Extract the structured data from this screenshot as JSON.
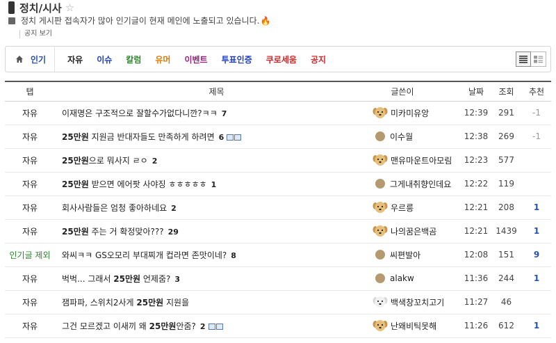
{
  "header": {
    "title": "정치/시사",
    "notice": "정치 게시판 접속자가 많아 인기글이 현재 메인에 노출되고 있습니다.",
    "notice_link": "공지 보기"
  },
  "tabs": {
    "home": "인기",
    "items": [
      {
        "label": "자유",
        "color": "#222222"
      },
      {
        "label": "이슈",
        "color": "#2040c0"
      },
      {
        "label": "칼럼",
        "color": "#2a8a2a"
      },
      {
        "label": "유머",
        "color": "#e07b00"
      },
      {
        "label": "이벤트",
        "color": "#9a1f7c"
      },
      {
        "label": "투표인증",
        "color": "#2040c0"
      },
      {
        "label": "쿠로세움",
        "color": "#d4252a"
      },
      {
        "label": "공지",
        "color": "#d4252a"
      }
    ]
  },
  "table": {
    "headers": {
      "tab": "탭",
      "title": "제목",
      "writer": "글쓴이",
      "date": "날짜",
      "views": "조회",
      "rec": "추천"
    },
    "rows": [
      {
        "tab": "자유",
        "pre": "이재명은 구조적으로 잘할수가없다니깐?ㅋㅋ",
        "bold": "",
        "post": "",
        "comments": "7",
        "img": false,
        "avatar": "dog",
        "writer": "미카미유앙",
        "date": "12:39",
        "views": "291",
        "rec": "-1"
      },
      {
        "tab": "자유",
        "pre": "",
        "bold": "25만원",
        "post": " 지원금 반대자들도 만족하게 하려면",
        "comments": "6",
        "img": true,
        "avatar": "dot",
        "writer": "이수월",
        "date": "12:38",
        "views": "269",
        "rec": "-1"
      },
      {
        "tab": "자유",
        "pre": "",
        "bold": "25만원",
        "post": "으로 뭐사지 ㄹㅇ",
        "comments": "2",
        "img": false,
        "avatar": "dog",
        "writer": "맨유마운트아모림",
        "date": "12:23",
        "views": "577",
        "rec": ""
      },
      {
        "tab": "자유",
        "pre": "",
        "bold": "25만원",
        "post": " 받으면 에어팟 사야징 ㅎㅎㅎㅎㅎ",
        "comments": "1",
        "img": false,
        "avatar": "dot",
        "writer": "그게내취향인데요",
        "date": "12:22",
        "views": "119",
        "rec": ""
      },
      {
        "tab": "자유",
        "pre": "회사사람들은 엄청 좋아하네요",
        "bold": "",
        "post": "",
        "comments": "2",
        "img": false,
        "avatar": "dog",
        "writer": "우르릉",
        "date": "12:21",
        "views": "208",
        "rec": "1"
      },
      {
        "tab": "자유",
        "pre": "",
        "bold": "25만원",
        "post": " 주는 거 확정맞아???",
        "comments": "29",
        "img": false,
        "avatar": "dog2",
        "writer": "나의꿈은백곰",
        "date": "12:21",
        "views": "1439",
        "rec": "1"
      },
      {
        "tab": "인기글 제외",
        "pre": "와씨ㅋㅋ GS오모리 부대찌개 컵라면 존맛이네?",
        "bold": "",
        "post": "",
        "comments": "8",
        "img": false,
        "avatar": "dot",
        "writer": "씨편발아",
        "date": "12:08",
        "views": "151",
        "rec": "9"
      },
      {
        "tab": "자유",
        "pre": "벅벅... 그래서 ",
        "bold": "25만원",
        "post": " 언제줌?",
        "comments": "3",
        "img": false,
        "avatar": "dot",
        "writer": "alakw",
        "date": "11:36",
        "views": "244",
        "rec": "1"
      },
      {
        "tab": "자유",
        "pre": "잼파파, 스위치2사게 ",
        "bold": "25만원",
        "post": " 지원을",
        "comments": "",
        "img": false,
        "avatar": "white",
        "writer": "백색창꼬치고기",
        "date": "11:27",
        "views": "46",
        "rec": ""
      },
      {
        "tab": "자유",
        "pre": "그건 모르겠고 이새끼 왜 ",
        "bold": "25만원",
        "post": "안줌?",
        "comments": "2",
        "img": true,
        "avatar": "dog2",
        "writer": "난왜비틱못해",
        "date": "11:26",
        "views": "612",
        "rec": "1"
      }
    ]
  },
  "colors": {
    "accent": "#2451b3",
    "excluded_tab": "#2a8a2a"
  }
}
